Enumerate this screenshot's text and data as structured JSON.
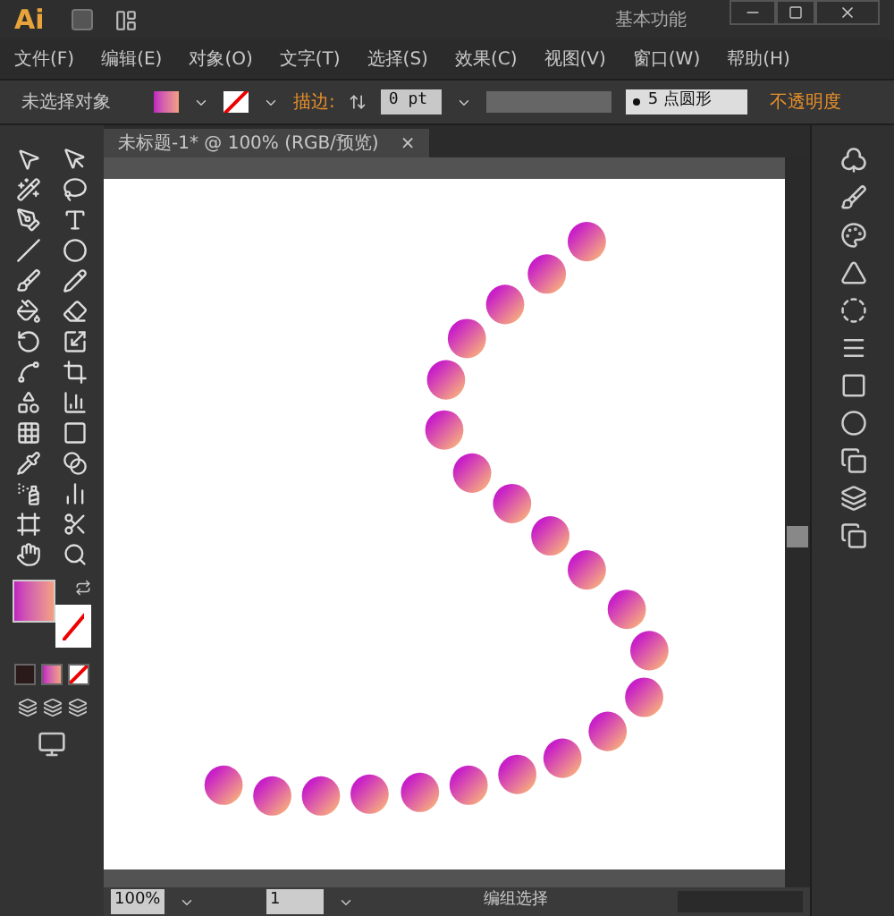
{
  "title_bar": {
    "logo": "Ai",
    "workspace": "基本功能"
  },
  "menu": [
    "文件(F)",
    "编辑(E)",
    "对象(O)",
    "文字(T)",
    "选择(S)",
    "效果(C)",
    "视图(V)",
    "窗口(W)",
    "帮助(H)"
  ],
  "control_bar": {
    "selection": "未选择对象",
    "stroke_label": "描边:",
    "stroke_weight": "0 pt",
    "brush": "5 点圆形",
    "opacity_label": "不透明度"
  },
  "document_tab": {
    "title": "未标题-1* @ 100% (RGB/预览)",
    "close": "×"
  },
  "status_bar": {
    "zoom": "100%",
    "page": "1",
    "status": "编组选择"
  }
}
